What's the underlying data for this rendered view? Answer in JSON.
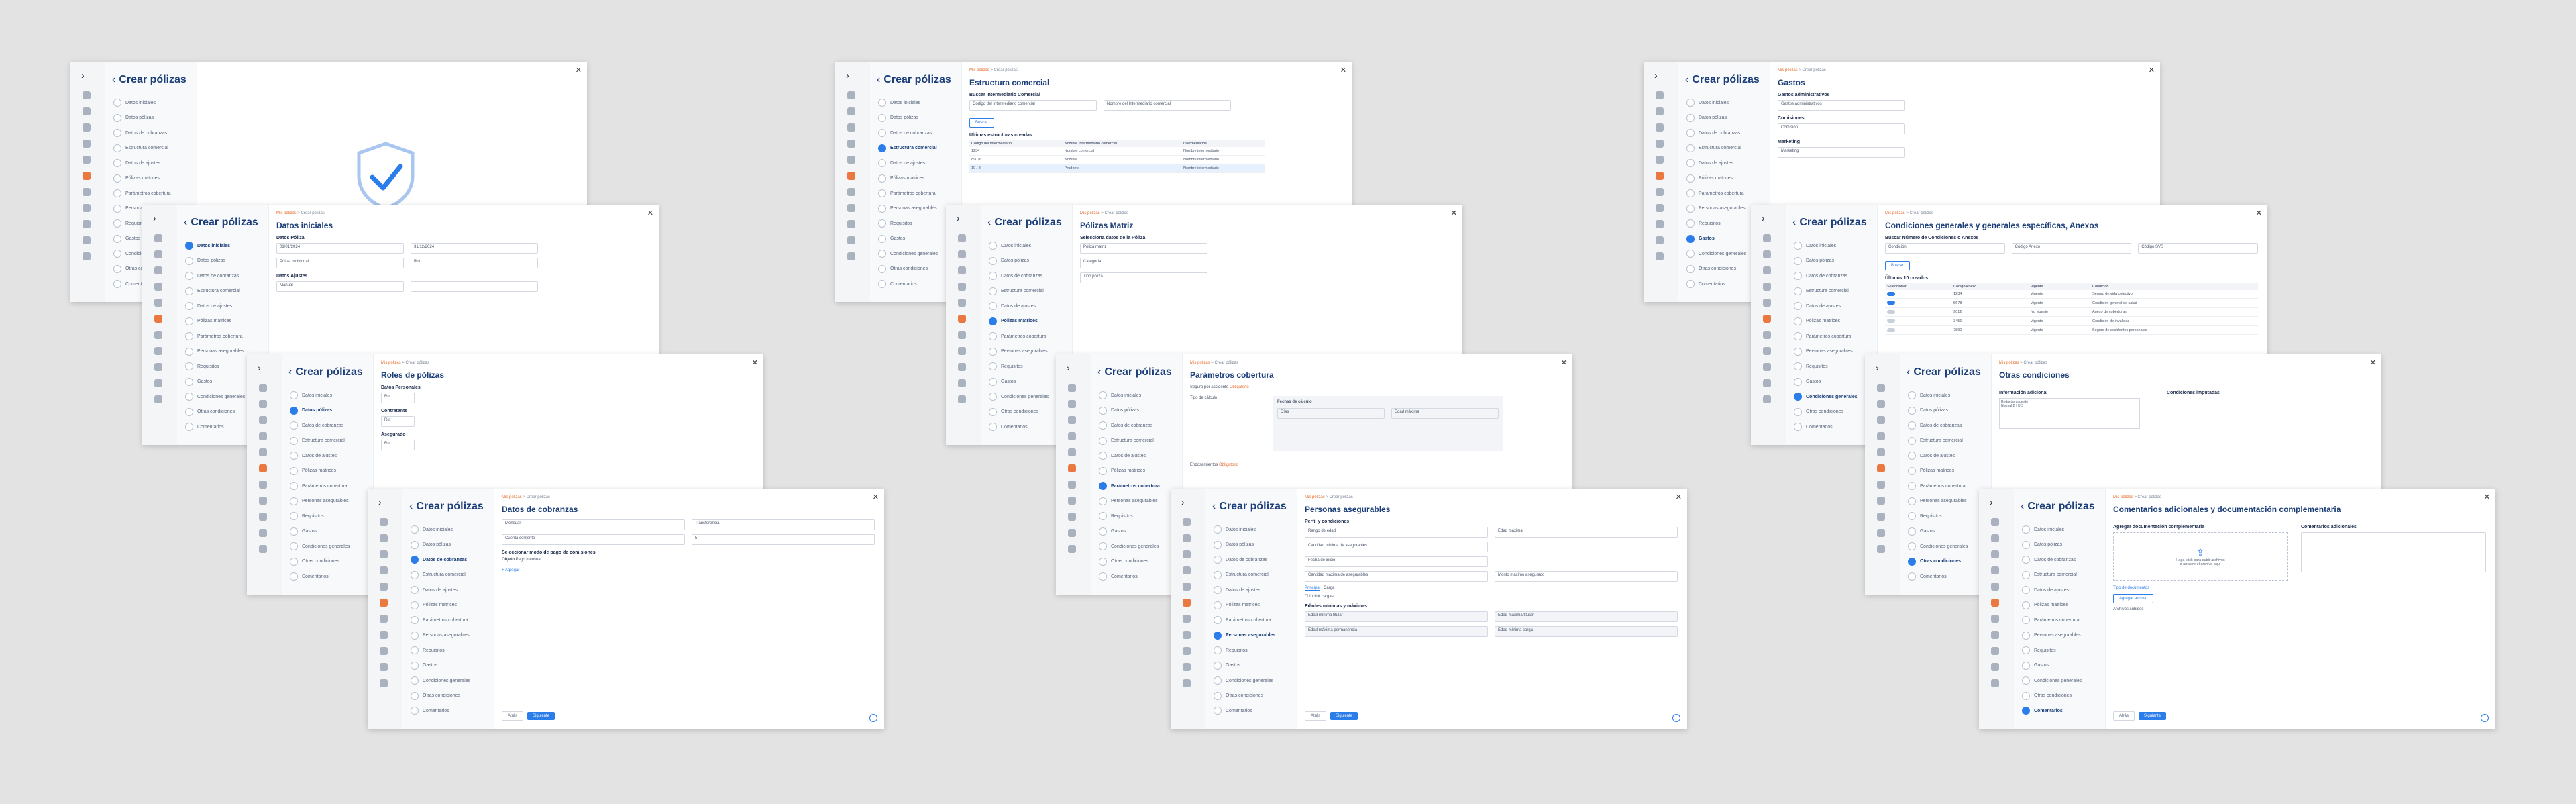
{
  "nav": {
    "title": "Crear pólizas",
    "rail_top": "›",
    "close": "✕",
    "items": [
      "Datos iniciales",
      "Datos pólizas",
      "Datos de cobranzas",
      "Estructura comercial",
      "Datos de ajustes",
      "Pólizas matrices",
      "Parámetros cobertura",
      "Personas asegurables",
      "Requisitos",
      "Gastos",
      "Condiciones generales",
      "Otras condiciones",
      "Comentarios"
    ]
  },
  "breadcrumb": {
    "root": "Mis pólizas",
    "sep": ">",
    "mid": "Crear pólizas"
  },
  "buttons": {
    "back": "Atrás",
    "next": "Siguiente",
    "search": "Buscar",
    "add": "+ Agregar"
  },
  "screens": [
    {
      "id": "s1",
      "title": "Crear pólizas"
    },
    {
      "id": "s2",
      "title": "Estructura comercial",
      "section": "Buscar Intermediario Comercial",
      "field1": "Código del Intermediario comercial",
      "field2": "Nombre del Intermediario comercial",
      "section2": "Últimas estructuras creadas",
      "headers": [
        "Código del Intermediario",
        "Nombre Intermediario comercial",
        "Intermediarios"
      ],
      "rows": [
        [
          "1234",
          "Nombre comercial",
          "Nombre intermediario"
        ],
        [
          "89076",
          "Nombre",
          "Nombre intermediario"
        ],
        [
          "10 / 8",
          "Prudente",
          "Nombre intermediario"
        ]
      ]
    },
    {
      "id": "s3",
      "title": "Gastos",
      "f1": "Gastos administrativos",
      "v1": "Gastos administrativos",
      "f2": "Comisiones",
      "v2": "Comisión",
      "f3": "Marketing",
      "v3": "Marketing"
    },
    {
      "id": "s4",
      "title": "Datos iniciales",
      "section": "Datos Póliza",
      "l1": "Fecha de Inicio",
      "v1": "01/01/2024",
      "l2": "Fecha de Término",
      "v2": "31/12/2024",
      "l3": "Tipo de póliza",
      "v3": "Póliza individual",
      "l4": "Rut contratante",
      "v4": "Rut",
      "section2": "Datos Ajustes",
      "l5": "Tipo de ajuste",
      "v5": "Manual"
    },
    {
      "id": "s5",
      "title": "Pólizas Matriz",
      "section": "Selecciona datos de la Póliza",
      "f1": "Póliza matriz",
      "f2": "Categoría",
      "f3": "Tipo póliza"
    },
    {
      "id": "s6",
      "title": "Condiciones generales y generales específicas, Anexos",
      "section": "Buscar Número de Condiciones o Anexos",
      "f1": "Condición",
      "f2": "Código Anexo",
      "f3": "Código SVS",
      "section2": "Últimos 10 creados",
      "headers": [
        "Seleccionar",
        "Código Anexo",
        "Vigente",
        "Condición"
      ],
      "rows": [
        [
          "on",
          "1234",
          "Vigente",
          "Seguro de vida colectivo"
        ],
        [
          "on",
          "5678",
          "Vigente",
          "Condición general de salud"
        ],
        [
          "off",
          "9012",
          "No vigente",
          "Anexo de coberturas"
        ],
        [
          "off",
          "3456",
          "Vigente",
          "Condición de invalidez"
        ],
        [
          "off",
          "7890",
          "Vigente",
          "Seguro de accidentes personales"
        ]
      ]
    },
    {
      "id": "s7",
      "title": "Roles de pólizas",
      "l1": "Datos Personales",
      "l2": "Contratante",
      "l3": "Asegurado",
      "v1": "Rut",
      "v2": "Rut",
      "v3": "Rut"
    },
    {
      "id": "s8",
      "title": "Parámetros cobertura",
      "check1": "Seguro por accidente",
      "req": "Obligatorio",
      "col1": "Fechas de cálculo",
      "col2": "Días",
      "col3": "Edad máxima",
      "row1": "Tipo de cálculo",
      "sub": "Endosamientos",
      "sub_req": "Obligatorio"
    },
    {
      "id": "s9",
      "title": "Otras condiciones",
      "f1": "Información adicional",
      "f2": "Condiciones imputadas",
      "ed1": "Redactar acuerdo",
      "ed2": "Normal"
    },
    {
      "id": "s10",
      "title": "Datos de cobranzas",
      "l1": "Frecuencia",
      "v1": "Mensual",
      "l2": "Forma de pago",
      "v2": "Transferencia",
      "l3": "Medio de pago",
      "v3": "Cuenta corriente",
      "l4": "Día de pago",
      "v4": "5",
      "section": "Seleccionar modo de pago de comisiones",
      "obj": "Objeto",
      "objv": "Pago mensual"
    },
    {
      "id": "s11",
      "title": "Personas asegurables",
      "section": "Perfil y condiciones",
      "f1": "Rango de edad",
      "f2": "Edad máxima",
      "f3": "Cantidad mínima de asegurables",
      "f4": "Fecha de inicio",
      "f5": "Cantidad máxima de asegurables",
      "f6": "Monto máximo asegurado",
      "tab1": "Principal",
      "tab2": "Carga",
      "check": "Incluir cargas",
      "section2": "Edades mínimas y máximas",
      "f7": "Edad mínima titular",
      "f8": "Edad máxima titular",
      "f9": "Edad máxima permanencia",
      "f10": "Edad mínima carga"
    },
    {
      "id": "s12",
      "title": "Comentarios adicionales y documentación complementaria",
      "section": "Agregar documentación complementaria",
      "section2": "Comentarios adicionales",
      "upload1": "Haga click para subir archivos",
      "upload2": "o arrastre el archivo aquí",
      "link": "Tipo de documentos",
      "b": "Agregar archivo",
      "file": "Archivos subidos"
    }
  ]
}
